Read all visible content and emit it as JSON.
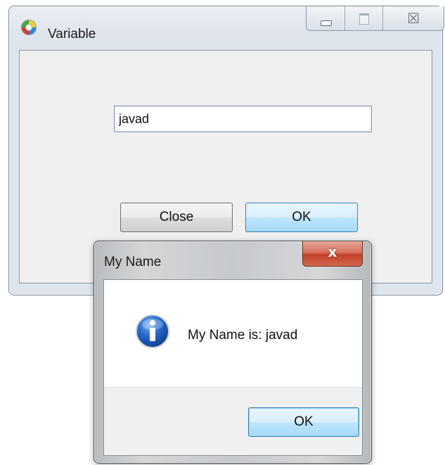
{
  "main_window": {
    "title": "Variable",
    "icon": "app-disc-icon",
    "caption_buttons": {
      "minimize_icon": "minimize-icon",
      "maximize_icon": "maximize-icon",
      "close_glyph": "☒"
    },
    "name_field": {
      "value": "javad"
    },
    "close_button_label": "Close",
    "ok_button_label": "OK"
  },
  "message_box": {
    "title": "My Name",
    "close_glyph": "x",
    "icon": "info-icon",
    "message": "My Name is: javad",
    "ok_button_label": "OK"
  },
  "colors": {
    "ok_button_accent": "#3c7fb1",
    "close_caption_red": "#c4402a",
    "info_icon_blue": "#1f5fbf"
  }
}
